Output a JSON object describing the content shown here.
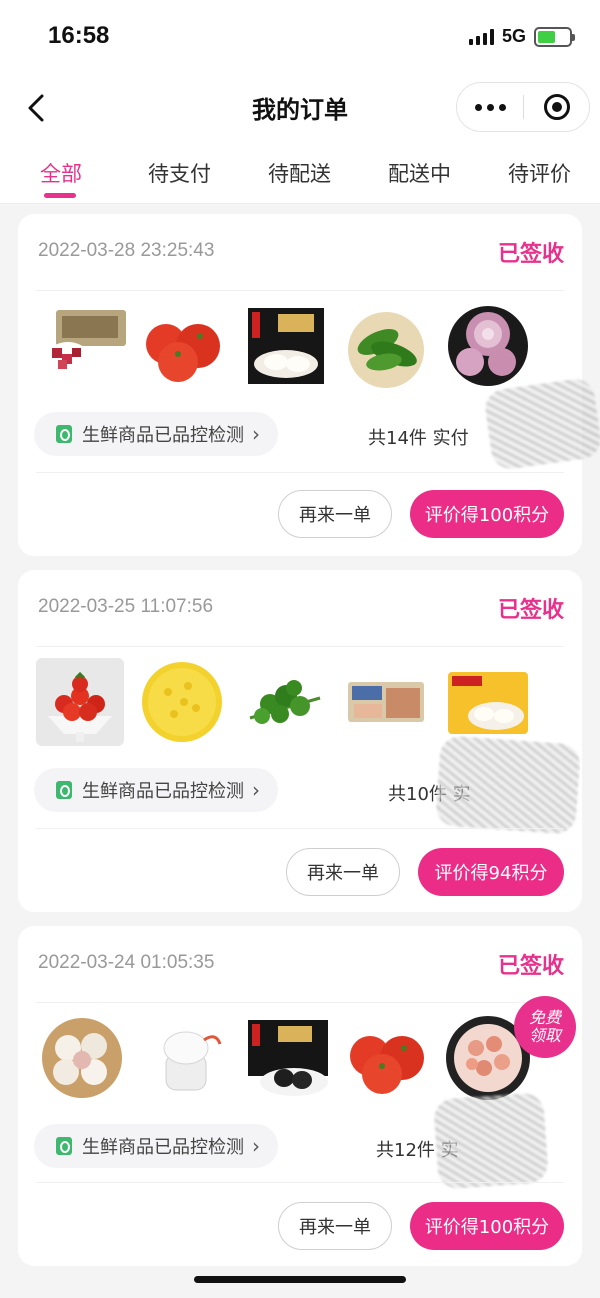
{
  "status_bar": {
    "time": "16:58",
    "network": "5G"
  },
  "nav": {
    "title": "我的订单"
  },
  "tabs": [
    "全部",
    "待支付",
    "待配送",
    "配送中",
    "待评价"
  ],
  "active_tab": 0,
  "orders": [
    {
      "time": "2022-03-28 23:25:43",
      "status": "已签收",
      "products": [
        "beef-pack",
        "tomatoes",
        "dumplings-box",
        "green-peppers",
        "onions"
      ],
      "qc_label": "生鲜商品已品控检测",
      "count_text": "共14件 实付",
      "again_label": "再来一单",
      "review_label": "评价得100积分"
    },
    {
      "time": "2022-03-25 11:07:56",
      "status": "已签收",
      "products": [
        "cherry-tomatoes",
        "corn-kernels",
        "cilantro",
        "meat-tray",
        "dumplings-bag"
      ],
      "qc_label": "生鲜商品已品控检测",
      "count_text": "共10件 实",
      "again_label": "再来一单",
      "review_label": "评价得94积分"
    },
    {
      "time": "2022-03-24 01:05:35",
      "status": "已签收",
      "products": [
        "garlic",
        "garlic-chopper",
        "preserved-eggs",
        "tomatoes",
        "shrimp"
      ],
      "qc_label": "生鲜商品已品控检测",
      "count_text": "共12件 实",
      "again_label": "再来一单",
      "review_label": "评价得100积分"
    }
  ],
  "promo": {
    "line1": "免费",
    "line2": "领取"
  },
  "colors": {
    "accent": "#e8318c",
    "button": "#ec2d87",
    "qc_green": "#3eb86f"
  }
}
